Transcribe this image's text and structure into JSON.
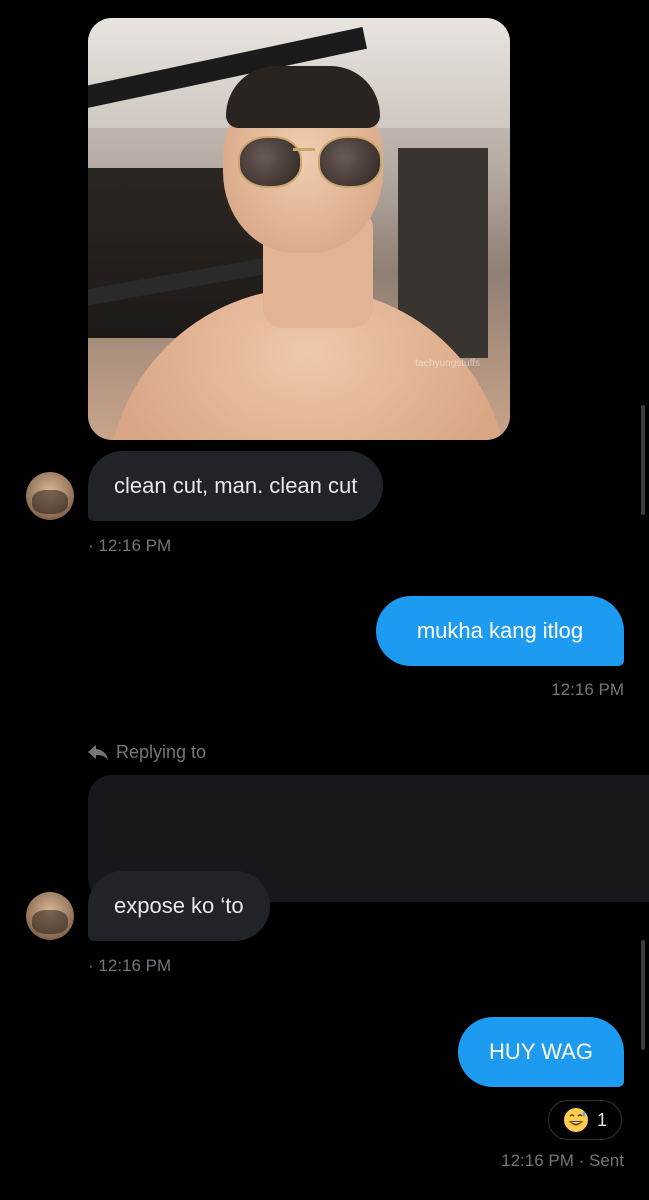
{
  "messages": [
    {
      "side": "received",
      "type": "image",
      "watermark": "taehyungstuffs"
    },
    {
      "side": "received",
      "text": "clean cut, man. clean cut",
      "time": "12:16 PM",
      "sender_prefix": "·"
    },
    {
      "side": "sent",
      "text": "mukha kang itlog",
      "time": "12:16 PM"
    },
    {
      "side": "received",
      "reply_context": "Replying to",
      "text": "expose ko ‘to",
      "time": "12:16 PM",
      "sender_prefix": "·"
    },
    {
      "side": "sent",
      "text": "HUY WAG",
      "time": "12:16 PM",
      "status": "Sent",
      "reaction": {
        "icon": "grinning-sweat-emoji",
        "count": "1"
      }
    }
  ],
  "colors": {
    "background": "#000000",
    "sent_bubble": "#1d9bf0",
    "received_bubble": "#202327",
    "meta_text": "#71767b"
  }
}
